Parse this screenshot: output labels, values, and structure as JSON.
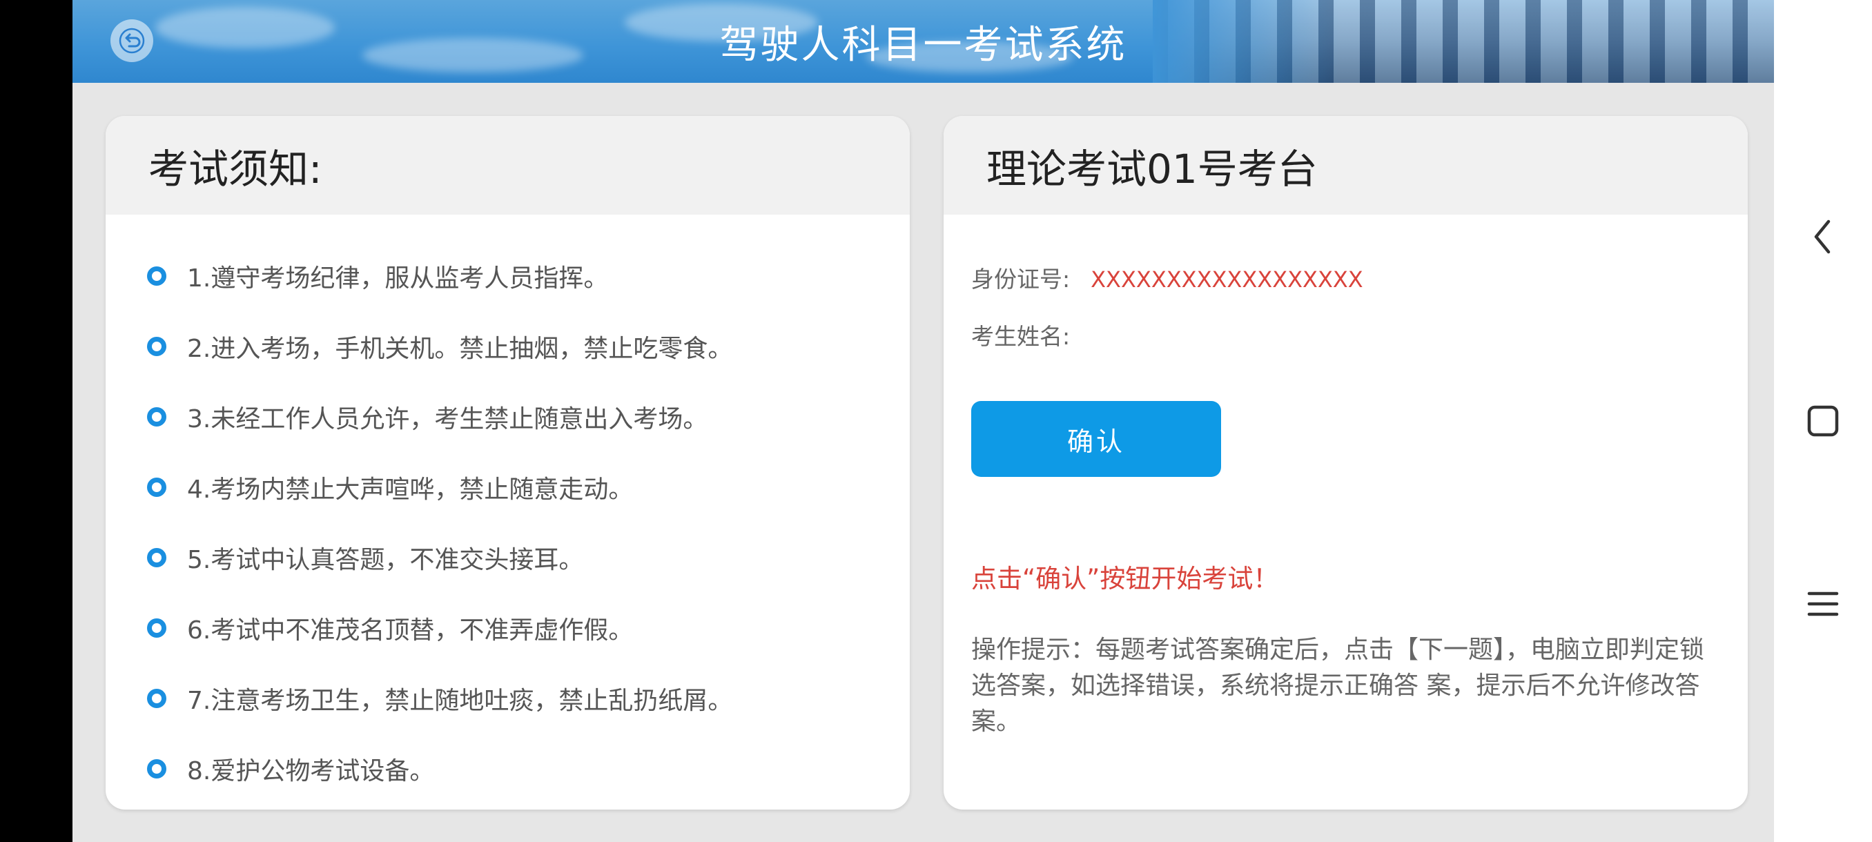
{
  "header": {
    "title": "驾驶人科目一考试系统"
  },
  "notice": {
    "heading": "考试须知:",
    "rules": [
      "1.遵守考场纪律，服从监考人员指挥。",
      "2.进入考场，手机关机。禁止抽烟，禁止吃零食。",
      "3.未经工作人员允许，考生禁止随意出入考场。",
      "4.考场内禁止大声喧哗，禁止随意走动。",
      "5.考试中认真答题，不准交头接耳。",
      "6.考试中不准茂名顶替，不准弄虚作假。",
      "7.注意考场卫生，禁止随地吐痰，禁止乱扔纸屑。",
      "8.爱护公物考试设备。"
    ]
  },
  "exam": {
    "heading": "理论考试01号考台",
    "id_label": "身份证号:",
    "id_value": "XXXXXXXXXXXXXXXXXX",
    "name_label": "考生姓名:",
    "name_value": "",
    "confirm_label": "确认",
    "start_hint": "点击“确认”按钮开始考试！",
    "op_hint": "操作提示：每题考试答案确定后，点击【下一题】，电脑立即判定锁选答案，如选择错误，系统将提示正确答 案，提示后不允许修改答案。"
  },
  "colors": {
    "accent": "#0e9ae6",
    "warning": "#d9433b"
  },
  "icons": {
    "back": "back-arrow-icon",
    "nav_back": "chevron-left-icon",
    "nav_home": "square-icon",
    "nav_menu": "menu-icon"
  }
}
